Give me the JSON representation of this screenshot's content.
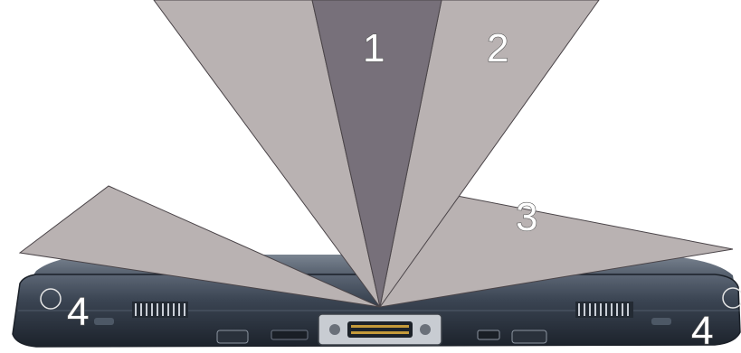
{
  "diagram": {
    "labels": {
      "panel_1": "1",
      "panel_2": "2",
      "panel_3": "3",
      "foot_left": "4",
      "foot_right": "4"
    },
    "colors": {
      "background": "#ffffff",
      "panel_light": "#b9b2b2",
      "panel_dark": "#77707a",
      "panel_edge": "#4a4448",
      "laptop_body": "#3a4452",
      "laptop_edge": "#1b2028",
      "laptop_highlight": "#6f7a88"
    }
  }
}
